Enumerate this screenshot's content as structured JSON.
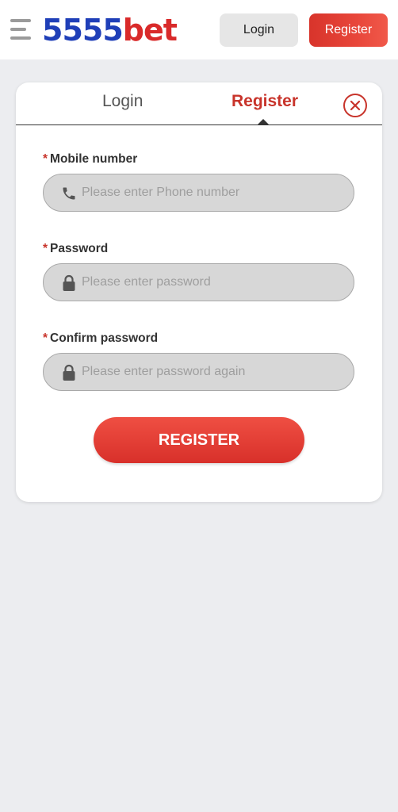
{
  "header": {
    "logo_number": "5555",
    "logo_word": "bet",
    "login_label": "Login",
    "register_label": "Register"
  },
  "tabs": {
    "login_label": "Login",
    "register_label": "Register",
    "active": "Register"
  },
  "form": {
    "mobile": {
      "label": "Mobile number",
      "placeholder": "Please enter Phone number",
      "icon": "phone-icon"
    },
    "password": {
      "label": "Password",
      "placeholder": "Please enter password",
      "icon": "lock-icon"
    },
    "confirm": {
      "label": "Confirm password",
      "placeholder": "Please enter password again",
      "icon": "lock-icon"
    },
    "required_marker": "*",
    "submit_label": "REGISTER"
  },
  "colors": {
    "brand_blue": "#1f3fb8",
    "brand_red": "#d92a2a",
    "accent": "#c8342b"
  }
}
